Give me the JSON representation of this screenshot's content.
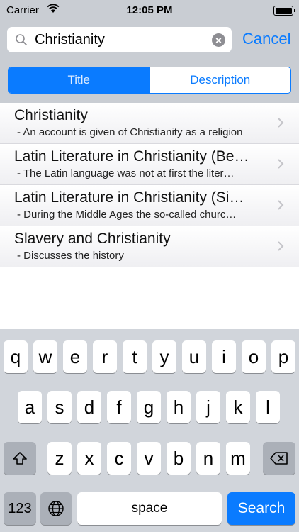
{
  "status_bar": {
    "carrier": "Carrier",
    "time": "12:05 PM"
  },
  "search": {
    "query": "Christianity",
    "cancel_label": "Cancel"
  },
  "segments": {
    "title_label": "Title",
    "description_label": "Description",
    "selected": "Title"
  },
  "results": [
    {
      "title": "Christianity",
      "subtitle": "- An account is given of Christianity as a religion"
    },
    {
      "title": "Latin Literature in Christianity (Be…",
      "subtitle": "- The Latin language was not at first the liter…"
    },
    {
      "title": "Latin Literature in Christianity (Si…",
      "subtitle": "- During the Middle Ages the so-called churc…"
    },
    {
      "title": "Slavery and Christianity",
      "subtitle": "- Discusses the history"
    }
  ],
  "keyboard": {
    "row1": [
      "q",
      "w",
      "e",
      "r",
      "t",
      "y",
      "u",
      "i",
      "o",
      "p"
    ],
    "row2": [
      "a",
      "s",
      "d",
      "f",
      "g",
      "h",
      "j",
      "k",
      "l"
    ],
    "row3": [
      "z",
      "x",
      "c",
      "v",
      "b",
      "n",
      "m"
    ],
    "num_label": "123",
    "space_label": "space",
    "search_label": "Search"
  },
  "colors": {
    "accent": "#0a7bff",
    "header_bg": "#c9cdd3",
    "keyboard_bg": "#d1d5db"
  }
}
